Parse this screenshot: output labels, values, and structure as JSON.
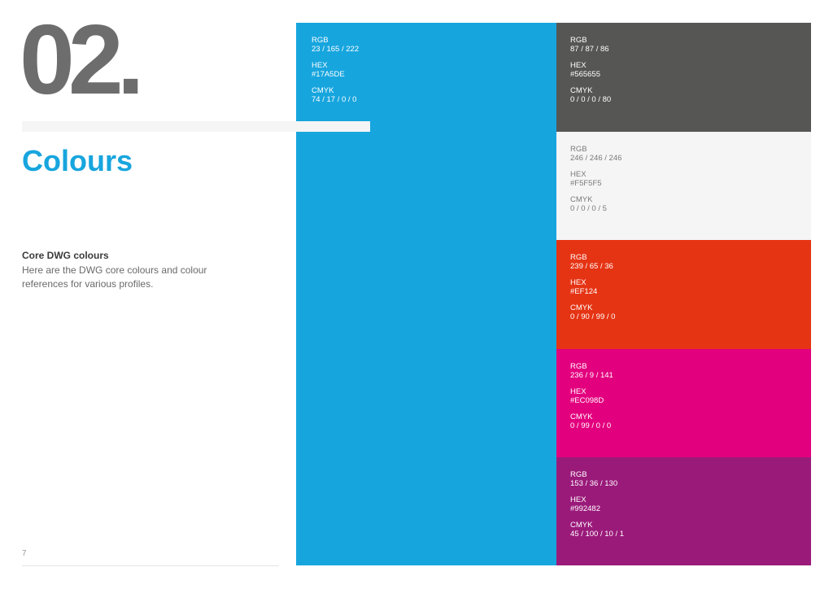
{
  "section": {
    "number": "02.",
    "title": "Colours",
    "number_color": "#6d6d6d",
    "title_color": "#17A5DE",
    "divider_color": "#F5F5F5"
  },
  "intro": {
    "heading": "Core DWG colours",
    "body": "Here are the DWG core colours and colour references for various profiles."
  },
  "page_number": "7",
  "swatches": [
    {
      "name": "blue",
      "background": "#17A5DE",
      "text_color": "#ffffff",
      "rgb_label": "RGB",
      "rgb": "23 / 165 / 222",
      "hex_label": "HEX",
      "hex": "#17A5DE",
      "cmyk_label": "CMYK",
      "cmyk": "74 / 17 / 0 / 0"
    },
    {
      "name": "dark-grey",
      "background": "#565655",
      "text_color": "#ffffff",
      "rgb_label": "RGB",
      "rgb": "87 / 87 / 86",
      "hex_label": "HEX",
      "hex": "#565655",
      "cmyk_label": "CMYK",
      "cmyk": "0 / 0 / 0 / 80"
    },
    {
      "name": "light-grey",
      "background": "#F5F5F5",
      "text_color": "#7a7a7a",
      "rgb_label": "RGB",
      "rgb": "246 / 246 / 246",
      "hex_label": "HEX",
      "hex": "#F5F5F5",
      "cmyk_label": "CMYK",
      "cmyk": "0 / 0 / 0 / 5"
    },
    {
      "name": "red",
      "background": "#E53414",
      "text_color": "#ffffff",
      "rgb_label": "RGB",
      "rgb": "239 / 65 / 36",
      "hex_label": "HEX",
      "hex": "#EF124",
      "cmyk_label": "CMYK",
      "cmyk": "0 / 90 / 99 / 0"
    },
    {
      "name": "magenta",
      "background": "#E3007E",
      "text_color": "#ffffff",
      "rgb_label": "RGB",
      "rgb": "236 / 9 / 141",
      "hex_label": "HEX",
      "hex": "#EC098D",
      "cmyk_label": "CMYK",
      "cmyk": "0 / 99 / 0 / 0"
    },
    {
      "name": "purple",
      "background": "#9A1A7A",
      "text_color": "#ffffff",
      "rgb_label": "RGB",
      "rgb": "153 / 36 / 130",
      "hex_label": "HEX",
      "hex": "#992482",
      "cmyk_label": "CMYK",
      "cmyk": "45 / 100 / 10 / 1"
    }
  ]
}
